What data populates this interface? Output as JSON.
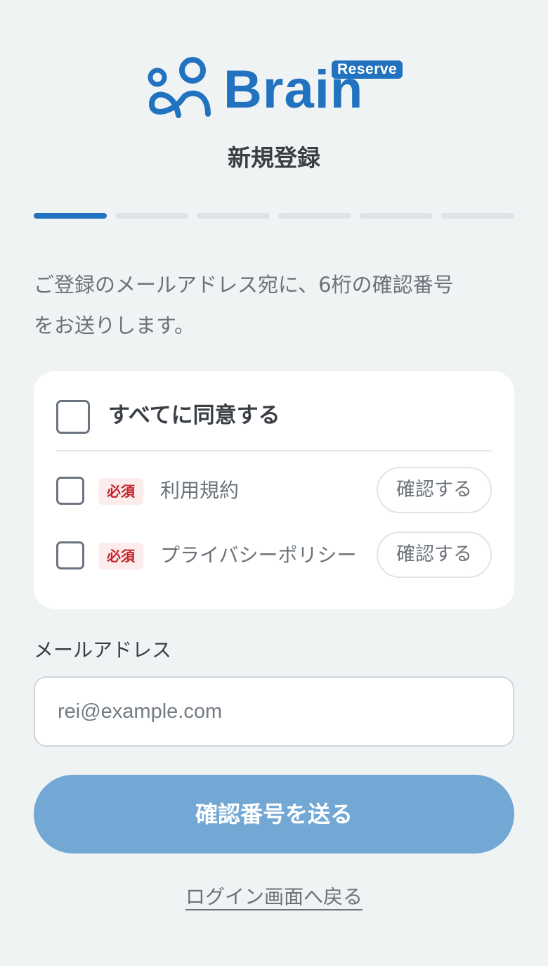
{
  "brand": {
    "name": "Brain",
    "badge": "Reserve",
    "accent_color": "#2172bf"
  },
  "page_title": "新規登録",
  "progress": {
    "total_steps": 6,
    "current_step": 1
  },
  "intro_text": {
    "line1": "ご登録のメールアドレス宛に、6桁の確認番号",
    "line2": "をお送りします。"
  },
  "agreement": {
    "agree_all_label": "すべてに同意する",
    "agree_all_checked": false,
    "items": [
      {
        "badge": "必須",
        "label": "利用規約",
        "button": "確認する",
        "checked": false
      },
      {
        "badge": "必須",
        "label": "プライバシーポリシー",
        "button": "確認する",
        "checked": false
      }
    ]
  },
  "email": {
    "label": "メールアドレス",
    "placeholder": "rei@example.com",
    "value": ""
  },
  "submit_label": "確認番号を送る",
  "back_link_label": "ログイン画面へ戻る"
}
